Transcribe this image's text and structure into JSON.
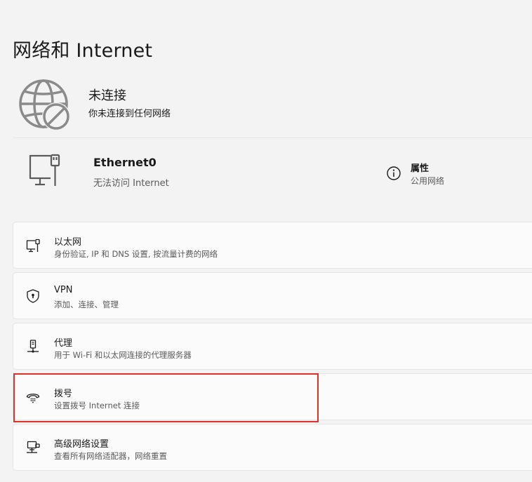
{
  "page": {
    "title": "网络和 Internet"
  },
  "status": {
    "title": "未连接",
    "description": "你未连接到任何网络",
    "icon": "globe-disconnected-icon"
  },
  "adapter": {
    "name": "Ethernet0",
    "status": "无法访问 Internet",
    "icon": "wired-monitor-icon",
    "properties": {
      "title": "属性",
      "value": "公用网络",
      "icon": "info-icon"
    }
  },
  "settings": {
    "items": [
      {
        "title": "以太网",
        "description": "身份验证, IP 和 DNS 设置, 按流量计费的网络",
        "icon": "ethernet-icon"
      },
      {
        "title": "VPN",
        "description": "添加、连接、管理",
        "icon": "vpn-shield-icon"
      },
      {
        "title": "代理",
        "description": "用于 Wi-Fi 和以太网连接的代理服务器",
        "icon": "proxy-icon"
      },
      {
        "title": "拨号",
        "description": "设置拨号 Internet 连接",
        "icon": "dialup-icon"
      },
      {
        "title": "高级网络设置",
        "description": "查看所有网络适配器，网络重置",
        "icon": "advanced-network-icon"
      }
    ]
  },
  "colors": {
    "background": "#f3f3f3",
    "card": "#fbfbfb",
    "border": "#e5e5e5",
    "icon_gray": "#8a8a8a",
    "highlight": "#e0302a"
  }
}
